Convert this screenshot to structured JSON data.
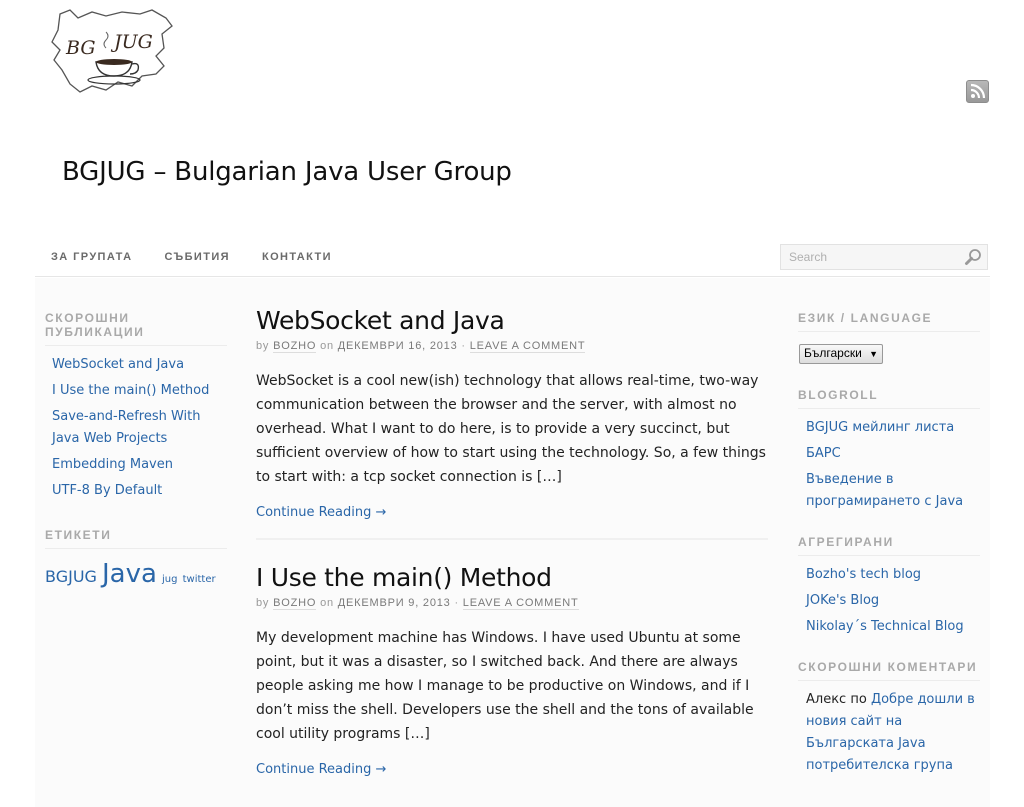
{
  "header": {
    "logo_alt": "BGJUG",
    "logo_text_left": "BG",
    "logo_text_right": "JUG",
    "site_title": "BGJUG – Bulgarian Java User Group",
    "rss_icon": "rss-icon"
  },
  "nav": {
    "items": [
      {
        "label": "ЗА ГРУПАТА"
      },
      {
        "label": "СЪБИТИЯ"
      },
      {
        "label": "КОНТАКТИ"
      }
    ],
    "search_placeholder": "Search",
    "search_value": ""
  },
  "left_sidebar": {
    "recent_posts": {
      "title": "СКОРОШНИ ПУБЛИКАЦИИ",
      "items": [
        {
          "label": "WebSocket and Java"
        },
        {
          "label": "I Use the main() Method"
        },
        {
          "label": "Save-and-Refresh With Java Web Projects"
        },
        {
          "label": "Embedding Maven"
        },
        {
          "label": "UTF-8 By Default"
        }
      ]
    },
    "tags": {
      "title": "ЕТИКЕТИ",
      "items": [
        {
          "label": "BGJUG"
        },
        {
          "label": "Java"
        },
        {
          "label": "jug"
        },
        {
          "label": "twitter"
        }
      ]
    }
  },
  "posts": [
    {
      "title": "WebSocket and Java",
      "by": "by",
      "author": "BOZHO",
      "on": "on",
      "date": "ДЕКЕМВРИ 16, 2013",
      "separator": "·",
      "comment_link": "LEAVE A COMMENT",
      "excerpt": "WebSocket is a cool new(ish) technology that allows real-time, two-way communication between the browser and the server, with almost no overhead. What I want to do here, is to provide a very succinct, but sufficient overview of how to start using the technology. So, a few things to start with: a tcp socket connection is […]",
      "continue": "Continue Reading →"
    },
    {
      "title": "I Use the main() Method",
      "by": "by",
      "author": "BOZHO",
      "on": "on",
      "date": "ДЕКЕМВРИ 9, 2013",
      "separator": "·",
      "comment_link": "LEAVE A COMMENT",
      "excerpt": "My development machine has Windows. I have used Ubuntu at some point, but it was a disaster, so I switched back. And there are always people asking me how I manage to be productive on Windows, and if I don’t miss the shell. Developers use the shell and the tons of available cool utility programs […]",
      "continue": "Continue Reading →"
    }
  ],
  "right_sidebar": {
    "language": {
      "title": "ЕЗИК / LANGUAGE",
      "selected": "Български",
      "arrow": "▼"
    },
    "blogroll": {
      "title": "BLOGROLL",
      "items": [
        {
          "label": "BGJUG мейлинг листа"
        },
        {
          "label": "БАРС"
        },
        {
          "label": "Въведение в програмирането с Java"
        }
      ]
    },
    "aggregated": {
      "title": "АГРЕГИРАНИ",
      "items": [
        {
          "label": "Bozho's tech blog"
        },
        {
          "label": "JOKe's Blog"
        },
        {
          "label": "Nikolay´s Technical Blog"
        }
      ]
    },
    "recent_comments": {
      "title": "СКОРОШНИ КОМЕНТАРИ",
      "items": [
        {
          "author": "Алекс",
          "by": "по",
          "post": "Добре дошли в новия сайт на Българската Java потребителска група"
        }
      ]
    }
  },
  "colors": {
    "link": "#2a66a8",
    "widget_title": "#a9a9a9",
    "nav_text": "#6a6a6a",
    "content_bg": "#fbfbfb"
  }
}
